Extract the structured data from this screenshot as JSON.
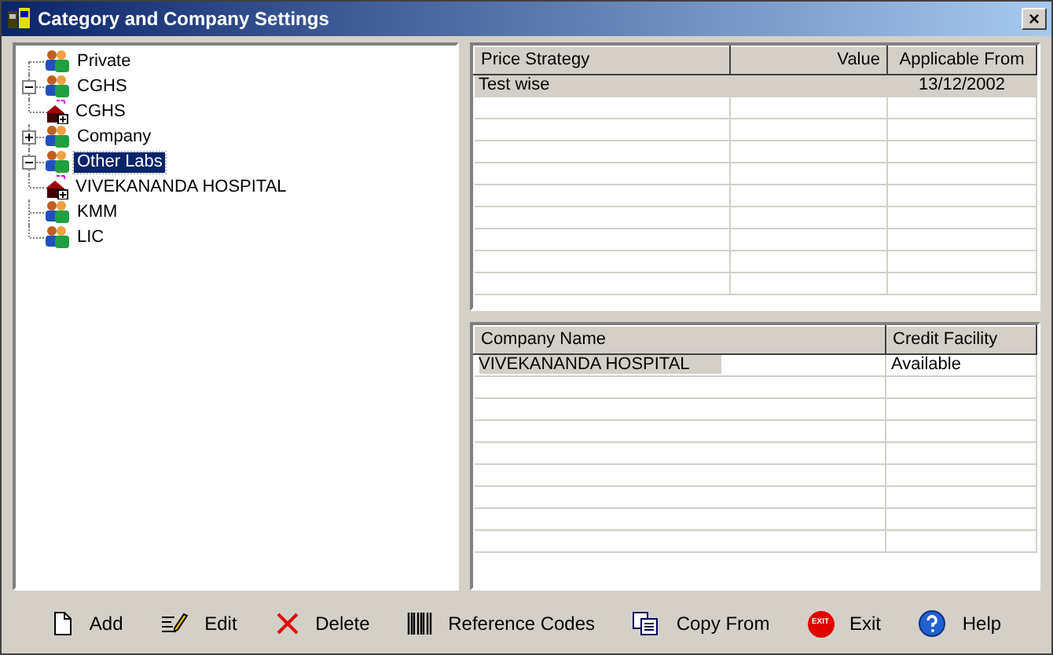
{
  "window": {
    "title": "Category and Company Settings",
    "close": "×"
  },
  "tree": [
    {
      "label": "Private",
      "kind": "group",
      "selected": false
    },
    {
      "label": "CGHS",
      "kind": "group",
      "selected": false,
      "expanded": true,
      "children": [
        {
          "label": "CGHS",
          "kind": "hospital",
          "selected": false
        }
      ]
    },
    {
      "label": "Company",
      "kind": "group",
      "selected": false,
      "expanded": false
    },
    {
      "label": "Other Labs",
      "kind": "group",
      "selected": true,
      "expanded": true,
      "children": [
        {
          "label": "VIVEKANANDA HOSPITAL",
          "kind": "hospital",
          "selected": false
        }
      ]
    },
    {
      "label": "KMM",
      "kind": "group",
      "selected": false
    },
    {
      "label": "LIC",
      "kind": "group",
      "selected": false
    }
  ],
  "price_table": {
    "columns": [
      {
        "label": "Price Strategy"
      },
      {
        "label": "Value"
      },
      {
        "label": "Applicable From"
      }
    ],
    "rows": [
      {
        "cells": [
          "Test wise",
          "",
          "13/12/2002"
        ],
        "selected": true
      }
    ]
  },
  "company_table": {
    "columns": [
      {
        "label": "Company Name"
      },
      {
        "label": "Credit Facility"
      }
    ],
    "rows": [
      {
        "cells": [
          "VIVEKANANDA HOSPITAL",
          "Available"
        ],
        "selected": true
      }
    ]
  },
  "toolbar": [
    {
      "kind": "add",
      "label": "Add"
    },
    {
      "kind": "edit",
      "label": "Edit"
    },
    {
      "kind": "delete",
      "label": "Delete"
    },
    {
      "kind": "codes",
      "label": "Reference Codes"
    },
    {
      "kind": "copy",
      "label": "Copy From"
    },
    {
      "kind": "exit",
      "label": "Exit",
      "icon_text": "EXIT"
    },
    {
      "kind": "help",
      "label": "Help"
    }
  ]
}
